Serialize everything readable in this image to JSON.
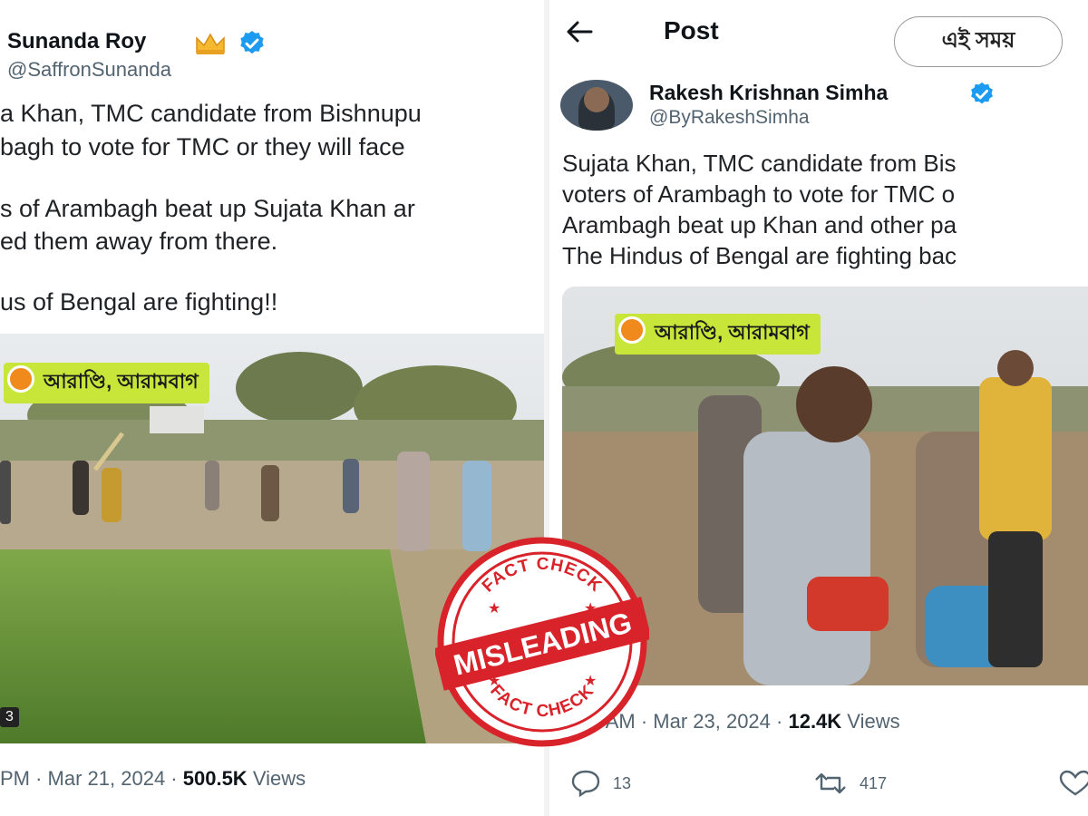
{
  "left_tweet": {
    "name": "Sunanda Roy",
    "handle": "@SaffronSunanda",
    "text_lines": [
      "a Khan, TMC candidate from Bishnupu",
      "bagh to vote for TMC or they will face",
      "s of Arambagh beat up Sujata Khan ar",
      "ed them away from there.",
      "us of Bengal are fighting!!"
    ],
    "video_location": "আরাণ্ডি, আরামবাগ",
    "video_badge": "3",
    "meta_time": "PM · Mar 21, 2024 · ",
    "meta_views_count": "500.5K",
    "meta_views_label": " Views"
  },
  "right_tweet": {
    "header_title": "Post",
    "name": "Rakesh Krishnan Simha",
    "handle": "@ByRakeshSimha",
    "text_lines": [
      "Sujata Khan, TMC candidate from Bis",
      "voters of Arambagh to vote for TMC o",
      "Arambagh beat up Khan and other pa",
      "The Hindus of Bengal are fighting bac"
    ],
    "video_location": "আরাণ্ডি, আরামবাগ",
    "meta_time": "0:10 AM · Mar 23, 2024 · ",
    "meta_views_count": "12.4K",
    "meta_views_label": " Views",
    "replies": "13",
    "reposts": "417"
  },
  "logo_text": "এই সময়",
  "stamp": {
    "top_text": "FACT CHECK",
    "main_text": "MISLEADING",
    "bottom_text": "FACT CHECK"
  },
  "colors": {
    "verified_blue": "#1d9bf0",
    "stamp_red": "#d8232a",
    "location_tag": "#c8e63a"
  },
  "icons": [
    "crown-emoji-icon",
    "verified-badge-icon",
    "back-arrow-icon",
    "reply-icon",
    "repost-icon",
    "like-icon",
    "location-pin-icon"
  ]
}
